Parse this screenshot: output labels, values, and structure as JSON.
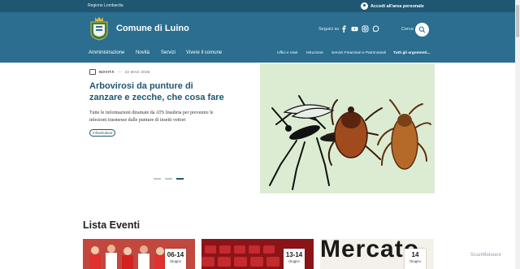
{
  "topbar": {
    "region": "Regione Lombardia",
    "login_label": "Accedi all'area personale"
  },
  "header": {
    "site_title": "Comune di Luino",
    "social_label": "Seguici su",
    "social_icons": [
      "facebook-icon",
      "youtube-icon",
      "instagram-icon",
      "whatsapp-icon"
    ],
    "search_label": "Cerca"
  },
  "nav": {
    "primary": [
      "Amministrazione",
      "Novità",
      "Servizi",
      "Vivere il comune"
    ],
    "secondary": [
      "Uffici e orari",
      "Istruzione",
      "Servizi Finanziari e Patrimoniali"
    ],
    "all_topics": "Tutti gli argomenti..."
  },
  "hero": {
    "kind": "NOVITÀ",
    "dash": "—",
    "date": "22 MAG 2026",
    "title": "Arbovirosi da punture di zanzare e zecche, che cosa fare",
    "description": "Tutte le informazioni diramate da ATS Insubria per prevenire le infezioni trasmesse dalle punture di insetti vettori",
    "tag": "Infrastruttura",
    "slides_total": 3,
    "slide_active": 3
  },
  "events": {
    "title": "Lista Eventi",
    "items": [
      {
        "day": "06-14",
        "month": "Giugno"
      },
      {
        "day": "13-14",
        "month": "Giugno"
      },
      {
        "day": "14",
        "month": "Giugno",
        "image_text": "Mercato"
      }
    ]
  },
  "watermark": "ScanMalware",
  "colors": {
    "brand_dark": "#1f5772",
    "brand": "#2b6e8f",
    "hero_bg": "#dcecd2"
  }
}
